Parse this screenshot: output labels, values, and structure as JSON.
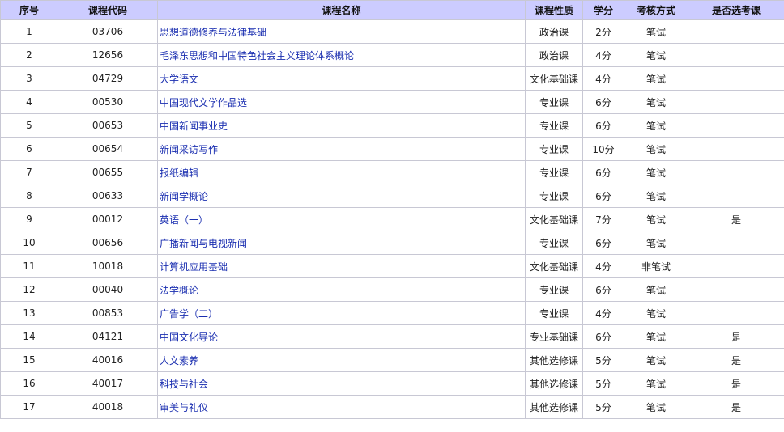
{
  "table": {
    "headers": {
      "index": "序号",
      "code": "课程代码",
      "name": "课程名称",
      "type": "课程性质",
      "credits": "学分",
      "exam": "考核方式",
      "elective": "是否选考课"
    },
    "rows": [
      {
        "index": "1",
        "code": "03706",
        "name": "思想道德修养与法律基础",
        "type": "政治课",
        "credits": "2分",
        "exam": "笔试",
        "elective": ""
      },
      {
        "index": "2",
        "code": "12656",
        "name": "毛泽东思想和中国特色社会主义理论体系概论",
        "type": "政治课",
        "credits": "4分",
        "exam": "笔试",
        "elective": ""
      },
      {
        "index": "3",
        "code": "04729",
        "name": "大学语文",
        "type": "文化基础课",
        "credits": "4分",
        "exam": "笔试",
        "elective": ""
      },
      {
        "index": "4",
        "code": "00530",
        "name": "中国现代文学作品选",
        "type": "专业课",
        "credits": "6分",
        "exam": "笔试",
        "elective": ""
      },
      {
        "index": "5",
        "code": "00653",
        "name": "中国新闻事业史",
        "type": "专业课",
        "credits": "6分",
        "exam": "笔试",
        "elective": ""
      },
      {
        "index": "6",
        "code": "00654",
        "name": "新闻采访写作",
        "type": "专业课",
        "credits": "10分",
        "exam": "笔试",
        "elective": ""
      },
      {
        "index": "7",
        "code": "00655",
        "name": "报纸编辑",
        "type": "专业课",
        "credits": "6分",
        "exam": "笔试",
        "elective": ""
      },
      {
        "index": "8",
        "code": "00633",
        "name": "新闻学概论",
        "type": "专业课",
        "credits": "6分",
        "exam": "笔试",
        "elective": ""
      },
      {
        "index": "9",
        "code": "00012",
        "name": "英语（一）",
        "type": "文化基础课",
        "credits": "7分",
        "exam": "笔试",
        "elective": "是"
      },
      {
        "index": "10",
        "code": "00656",
        "name": "广播新闻与电视新闻",
        "type": "专业课",
        "credits": "6分",
        "exam": "笔试",
        "elective": ""
      },
      {
        "index": "11",
        "code": "10018",
        "name": "计算机应用基础",
        "type": "文化基础课",
        "credits": "4分",
        "exam": "非笔试",
        "elective": ""
      },
      {
        "index": "12",
        "code": "00040",
        "name": "法学概论",
        "type": "专业课",
        "credits": "6分",
        "exam": "笔试",
        "elective": ""
      },
      {
        "index": "13",
        "code": "00853",
        "name": "广告学（二）",
        "type": "专业课",
        "credits": "4分",
        "exam": "笔试",
        "elective": ""
      },
      {
        "index": "14",
        "code": "04121",
        "name": "中国文化导论",
        "type": "专业基础课",
        "credits": "6分",
        "exam": "笔试",
        "elective": "是"
      },
      {
        "index": "15",
        "code": "40016",
        "name": "人文素养",
        "type": "其他选修课",
        "credits": "5分",
        "exam": "笔试",
        "elective": "是"
      },
      {
        "index": "16",
        "code": "40017",
        "name": "科技与社会",
        "type": "其他选修课",
        "credits": "5分",
        "exam": "笔试",
        "elective": "是"
      },
      {
        "index": "17",
        "code": "40018",
        "name": "审美与礼仪",
        "type": "其他选修课",
        "credits": "5分",
        "exam": "笔试",
        "elective": "是"
      }
    ]
  }
}
